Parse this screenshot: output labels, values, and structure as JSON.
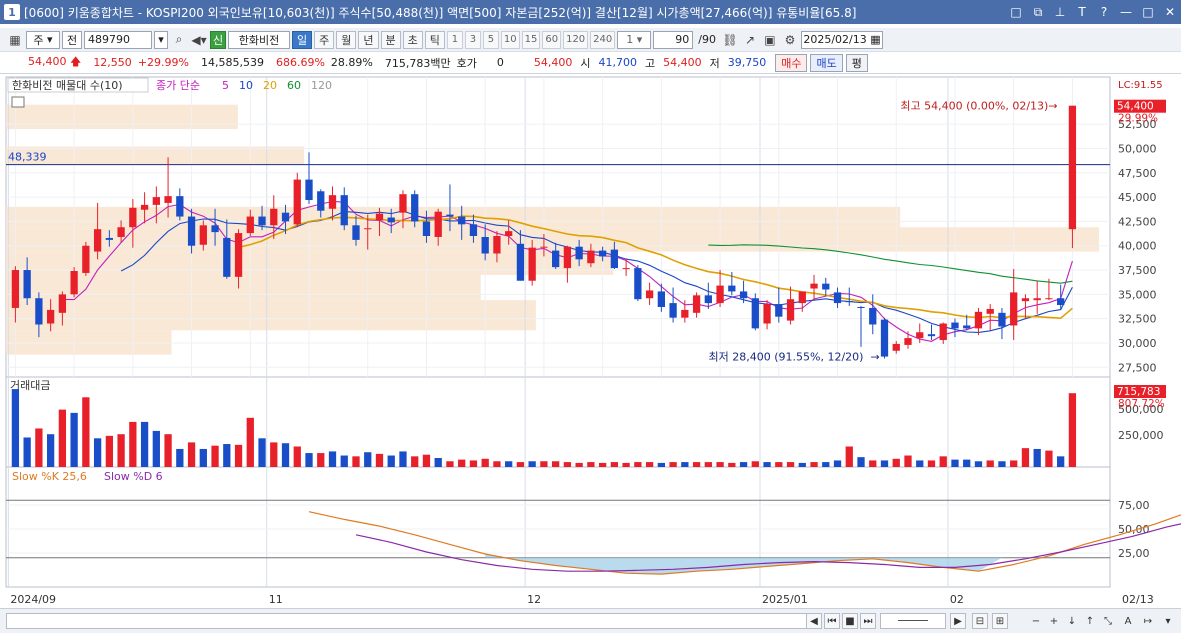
{
  "window": {
    "number": "1",
    "title": "[0600] 키움종합차트 - KOSPI200 외국인보유[10,603(천)] 주식수[50,488(천)] 액면[500] 자본금[252(억)] 결산[12월] 시가총액[27,466(억)] 유통비율[65.8]",
    "controls": [
      "□",
      "⧉",
      "⊥",
      "T",
      "?",
      "—",
      "□",
      "✕"
    ]
  },
  "toolbar": {
    "type_select": "주",
    "prefix": "전",
    "code": "489790",
    "sin_badge": "신",
    "stock_name": "한화비전",
    "periods": [
      "일",
      "주",
      "월",
      "년",
      "분",
      "초",
      "틱"
    ],
    "selected_period": "일",
    "minute_buttons": [
      "1",
      "3",
      "5",
      "10",
      "15",
      "60",
      "120",
      "240"
    ],
    "interval_value": "1",
    "count_display": "90",
    "count_total": "/90",
    "date": "2025/02/13"
  },
  "quote": {
    "price": "54,400",
    "change": "12,550",
    "change_pct": "+29.99%",
    "volume": "14,585,539",
    "volume_ratio": "686.69%",
    "turnover": "28.89%",
    "amount": "715,783백만",
    "hoga_label": "호가",
    "hoga_value": "0",
    "hoga_price": "54,400",
    "open_label": "시",
    "open": "41,700",
    "high_label": "고",
    "high": "54,400",
    "low_label": "저",
    "low": "39,750",
    "buy_label": "매수",
    "sell_label": "매도",
    "eval_label": "평"
  },
  "chart_data": {
    "type": "candlestick",
    "legend": {
      "sdb": "한화비전 매물대 수(10)",
      "ma_label": "종가 단순",
      "ma_periods": [
        "5",
        "10",
        "20",
        "60",
        "120"
      ],
      "ma_colors": [
        "#c020c0",
        "#1a46c8",
        "#e0a000",
        "#109030",
        "#999999"
      ]
    },
    "price_axis": [
      "52,500",
      "50,000",
      "47,500",
      "45,000",
      "42,500",
      "40,000",
      "37,500",
      "35,000",
      "32,500",
      "30,000",
      "27,500"
    ],
    "ylim": [
      26500,
      55500
    ],
    "current_price_tag": "54,400",
    "current_pct_tag": "29.99%",
    "top_axis_label": "LC:91.55",
    "ref_line_value": 48339,
    "ref_line_label": "48,339",
    "annotation_high": "최고 54,400 (0.00%, 02/13)",
    "annotation_low": "최저 28,400 (91.55%, 12/20)",
    "candles": [
      [
        33600,
        37900,
        32100,
        37500
      ],
      [
        37500,
        38800,
        33900,
        34600
      ],
      [
        34600,
        35200,
        30600,
        31900
      ],
      [
        32000,
        34500,
        31200,
        33400
      ],
      [
        33100,
        35300,
        31800,
        35000
      ],
      [
        35000,
        37800,
        34700,
        37400
      ],
      [
        37200,
        40400,
        36900,
        40000
      ],
      [
        39400,
        44400,
        38600,
        41700
      ],
      [
        40800,
        41600,
        39900,
        40600
      ],
      [
        40900,
        42600,
        40300,
        41900
      ],
      [
        41900,
        44800,
        39800,
        43900
      ],
      [
        43700,
        45500,
        42300,
        44200
      ],
      [
        44200,
        46100,
        42300,
        45000
      ],
      [
        44400,
        49100,
        42900,
        45100
      ],
      [
        45100,
        45900,
        42600,
        43000
      ],
      [
        43000,
        43800,
        39200,
        40000
      ],
      [
        40100,
        42600,
        39500,
        42100
      ],
      [
        42100,
        43800,
        40000,
        41400
      ],
      [
        40800,
        42700,
        36600,
        36800
      ],
      [
        36800,
        41700,
        35600,
        41300
      ],
      [
        41300,
        43700,
        41000,
        43000
      ],
      [
        43000,
        44100,
        41600,
        42100
      ],
      [
        42100,
        45200,
        40700,
        43800
      ],
      [
        43400,
        44200,
        41200,
        42500
      ],
      [
        42200,
        47500,
        41900,
        46800
      ],
      [
        46800,
        49600,
        44300,
        44700
      ],
      [
        45600,
        45800,
        42900,
        43600
      ],
      [
        43800,
        46100,
        42600,
        45200
      ],
      [
        45200,
        46000,
        41600,
        42100
      ],
      [
        42100,
        43100,
        40000,
        40600
      ],
      [
        41800,
        43200,
        39600,
        41800
      ],
      [
        42600,
        43900,
        41000,
        43300
      ],
      [
        42900,
        43800,
        41300,
        42400
      ],
      [
        43400,
        45700,
        41800,
        45300
      ],
      [
        45300,
        45700,
        41900,
        42500
      ],
      [
        42500,
        43600,
        40300,
        41000
      ],
      [
        40900,
        43800,
        40000,
        43500
      ],
      [
        43200,
        46300,
        41500,
        43000
      ],
      [
        43000,
        44100,
        40600,
        42200
      ],
      [
        42200,
        43200,
        40300,
        41000
      ],
      [
        40900,
        42200,
        38500,
        39200
      ],
      [
        39200,
        41500,
        38300,
        41000
      ],
      [
        41000,
        42600,
        40100,
        41500
      ],
      [
        40200,
        41600,
        36400,
        36400
      ],
      [
        36400,
        40600,
        35900,
        39800
      ],
      [
        39800,
        41200,
        38900,
        39900
      ],
      [
        39500,
        40300,
        37600,
        37800
      ],
      [
        37700,
        40000,
        36200,
        39900
      ],
      [
        39900,
        40600,
        37900,
        38600
      ],
      [
        38200,
        40200,
        37800,
        39500
      ],
      [
        39500,
        39900,
        38400,
        38900
      ],
      [
        39600,
        40400,
        37600,
        37700
      ],
      [
        37700,
        38700,
        36900,
        37700
      ],
      [
        37700,
        38000,
        34300,
        34500
      ],
      [
        34600,
        36200,
        33900,
        35400
      ],
      [
        35300,
        36100,
        33200,
        33700
      ],
      [
        34100,
        35700,
        32100,
        32600
      ],
      [
        32600,
        34400,
        32100,
        33400
      ],
      [
        33100,
        35200,
        32600,
        34900
      ],
      [
        34900,
        36200,
        33500,
        34100
      ],
      [
        34100,
        37500,
        33700,
        35900
      ],
      [
        35900,
        37300,
        34900,
        35300
      ],
      [
        35300,
        36400,
        34100,
        34600
      ],
      [
        34600,
        35100,
        31300,
        31500
      ],
      [
        32000,
        34400,
        31400,
        34000
      ],
      [
        34000,
        35700,
        32100,
        32700
      ],
      [
        32300,
        35800,
        31900,
        34500
      ],
      [
        34100,
        35300,
        33200,
        35300
      ],
      [
        35600,
        37000,
        34400,
        36100
      ],
      [
        36100,
        36700,
        34800,
        35500
      ],
      [
        35200,
        35700,
        33600,
        34100
      ],
      [
        34300,
        35700,
        33800,
        34200
      ],
      [
        33700,
        33800,
        29600,
        33600
      ],
      [
        33600,
        35000,
        30900,
        31900
      ],
      [
        32400,
        32600,
        28400,
        28600
      ],
      [
        29200,
        30200,
        28900,
        29900
      ],
      [
        29800,
        31200,
        29400,
        30500
      ],
      [
        30500,
        32000,
        30000,
        31100
      ],
      [
        30900,
        31900,
        30300,
        30700
      ],
      [
        30300,
        32100,
        29900,
        32000
      ],
      [
        32100,
        32500,
        30600,
        31500
      ],
      [
        31800,
        32900,
        31300,
        31500
      ],
      [
        31500,
        33600,
        30800,
        33200
      ],
      [
        33000,
        34000,
        31300,
        33500
      ],
      [
        33100,
        33600,
        30400,
        31700
      ],
      [
        31800,
        37600,
        30300,
        35200
      ],
      [
        34300,
        35000,
        32500,
        34600
      ],
      [
        34400,
        36400,
        33000,
        34600
      ],
      [
        34600,
        36600,
        34400,
        34600
      ],
      [
        34600,
        36000,
        33400,
        33900
      ]
    ],
    "volume_axis": [
      "500,000",
      "250,000"
    ],
    "volume_title": "거래대금",
    "volume_tag": "715,783",
    "volume_pct_tag": "807.72%",
    "volumes": [
      [
        0.95,
        0
      ],
      [
        0.36,
        0
      ],
      [
        0.47,
        1
      ],
      [
        0.4,
        0
      ],
      [
        0.7,
        1
      ],
      [
        0.66,
        0
      ],
      [
        0.85,
        1
      ],
      [
        0.35,
        0
      ],
      [
        0.38,
        1
      ],
      [
        0.4,
        1
      ],
      [
        0.55,
        1
      ],
      [
        0.55,
        0
      ],
      [
        0.44,
        0
      ],
      [
        0.4,
        1
      ],
      [
        0.22,
        0
      ],
      [
        0.3,
        1
      ],
      [
        0.22,
        0
      ],
      [
        0.26,
        1
      ],
      [
        0.28,
        0
      ],
      [
        0.27,
        1
      ],
      [
        0.6,
        1
      ],
      [
        0.35,
        0
      ],
      [
        0.3,
        1
      ],
      [
        0.29,
        0
      ],
      [
        0.25,
        1
      ],
      [
        0.17,
        0
      ],
      [
        0.17,
        1
      ],
      [
        0.19,
        0
      ],
      [
        0.14,
        0
      ],
      [
        0.13,
        1
      ],
      [
        0.18,
        0
      ],
      [
        0.16,
        1
      ],
      [
        0.14,
        0
      ],
      [
        0.19,
        0
      ],
      [
        0.13,
        1
      ],
      [
        0.15,
        1
      ],
      [
        0.11,
        0
      ],
      [
        0.07,
        1
      ],
      [
        0.09,
        1
      ],
      [
        0.08,
        1
      ],
      [
        0.1,
        1
      ],
      [
        0.07,
        1
      ],
      [
        0.07,
        0
      ],
      [
        0.06,
        1
      ],
      [
        0.07,
        0
      ],
      [
        0.07,
        1
      ],
      [
        0.07,
        1
      ],
      [
        0.06,
        1
      ],
      [
        0.05,
        1
      ],
      [
        0.06,
        1
      ],
      [
        0.05,
        1
      ],
      [
        0.06,
        1
      ],
      [
        0.05,
        1
      ],
      [
        0.06,
        1
      ],
      [
        0.06,
        1
      ],
      [
        0.05,
        0
      ],
      [
        0.06,
        1
      ],
      [
        0.06,
        0
      ],
      [
        0.06,
        1
      ],
      [
        0.06,
        1
      ],
      [
        0.06,
        1
      ],
      [
        0.05,
        1
      ],
      [
        0.06,
        0
      ],
      [
        0.07,
        1
      ],
      [
        0.06,
        0
      ],
      [
        0.06,
        1
      ],
      [
        0.06,
        1
      ],
      [
        0.05,
        0
      ],
      [
        0.06,
        1
      ],
      [
        0.06,
        0
      ],
      [
        0.08,
        0
      ],
      [
        0.25,
        1
      ],
      [
        0.12,
        0
      ],
      [
        0.08,
        1
      ],
      [
        0.08,
        0
      ],
      [
        0.1,
        1
      ],
      [
        0.14,
        1
      ],
      [
        0.08,
        0
      ],
      [
        0.08,
        1
      ],
      [
        0.13,
        1
      ],
      [
        0.09,
        0
      ],
      [
        0.09,
        0
      ],
      [
        0.07,
        0
      ],
      [
        0.08,
        1
      ],
      [
        0.07,
        0
      ],
      [
        0.08,
        1
      ],
      [
        0.23,
        1
      ],
      [
        0.22,
        0
      ],
      [
        0.2,
        1
      ],
      [
        0.13,
        0
      ]
    ],
    "last_candle": [
      41700,
      54400,
      39750,
      54400
    ],
    "last_volume": [
      0.9,
      1
    ],
    "stoch_title_k": "Slow %K 25,6",
    "stoch_title_d": "Slow %D 6",
    "stoch_axis": [
      "75,00",
      "50,00",
      "25,00"
    ],
    "stoch_k": [
      [
        25,
        68
      ],
      [
        28,
        60
      ],
      [
        31,
        53
      ],
      [
        34,
        44
      ],
      [
        37,
        34
      ],
      [
        40,
        24
      ],
      [
        43,
        17
      ],
      [
        46,
        12
      ],
      [
        49,
        8
      ],
      [
        52,
        4
      ],
      [
        55,
        3
      ],
      [
        58,
        6
      ],
      [
        61,
        8
      ],
      [
        64,
        11
      ],
      [
        67,
        14
      ],
      [
        70,
        17
      ],
      [
        73,
        19
      ],
      [
        76,
        15
      ],
      [
        79,
        10
      ],
      [
        82,
        6
      ],
      [
        85,
        13
      ],
      [
        88,
        22
      ],
      [
        91,
        34
      ],
      [
        94,
        44
      ],
      [
        97,
        55
      ],
      [
        100,
        68
      ],
      [
        103,
        74
      ],
      [
        106,
        80
      ],
      [
        109,
        84
      ],
      [
        112,
        84
      ],
      [
        115,
        78
      ],
      [
        118,
        66
      ],
      [
        121,
        50
      ],
      [
        124,
        38
      ],
      [
        127,
        31
      ],
      [
        130,
        32
      ],
      [
        133,
        40
      ],
      [
        136,
        52
      ],
      [
        139,
        66
      ],
      [
        142,
        82
      ],
      [
        145,
        92
      ]
    ],
    "stoch_d": [
      [
        29,
        44
      ],
      [
        32,
        36
      ],
      [
        35,
        26
      ],
      [
        38,
        18
      ],
      [
        41,
        12
      ],
      [
        44,
        8
      ],
      [
        47,
        6
      ],
      [
        50,
        6
      ],
      [
        53,
        7
      ],
      [
        56,
        8
      ],
      [
        59,
        10
      ],
      [
        62,
        13
      ],
      [
        65,
        15
      ],
      [
        68,
        16
      ],
      [
        71,
        15
      ],
      [
        74,
        13
      ],
      [
        77,
        10
      ],
      [
        80,
        10
      ],
      [
        83,
        13
      ],
      [
        86,
        19
      ],
      [
        89,
        26
      ],
      [
        92,
        34
      ],
      [
        95,
        42
      ],
      [
        98,
        52
      ],
      [
        101,
        60
      ],
      [
        104,
        67
      ],
      [
        107,
        71
      ],
      [
        110,
        74
      ],
      [
        113,
        73
      ],
      [
        116,
        69
      ],
      [
        119,
        62
      ],
      [
        122,
        53
      ],
      [
        125,
        45
      ],
      [
        128,
        40
      ],
      [
        131,
        38
      ],
      [
        134,
        39
      ],
      [
        137,
        43
      ],
      [
        140,
        50
      ],
      [
        143,
        58
      ],
      [
        145,
        68
      ]
    ],
    "x_labels": [
      "2024/09",
      "11",
      "12",
      "2025/01",
      "02"
    ],
    "x_end_label": "02/13"
  }
}
